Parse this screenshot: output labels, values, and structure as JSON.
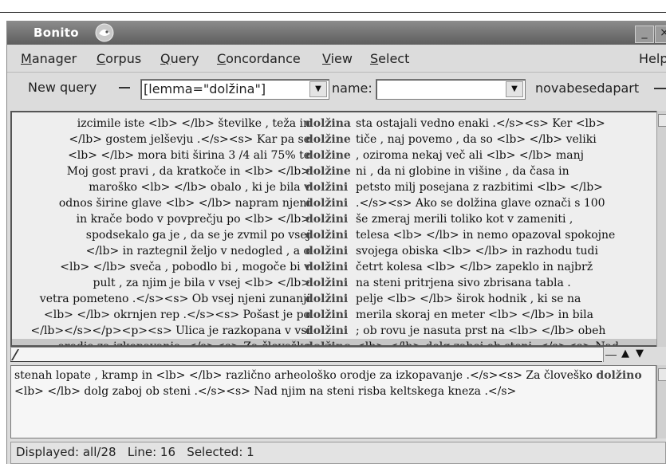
{
  "window": {
    "title": "Bonito"
  },
  "menu": [
    {
      "label": "Manager",
      "underline": "M",
      "rest": "anager"
    },
    {
      "label": "Corpus",
      "underline": "C",
      "rest": "orpus"
    },
    {
      "label": "Query",
      "underline": "Q",
      "rest": "uery"
    },
    {
      "label": "Concordance",
      "underline": "C",
      "rest": "oncordance"
    },
    {
      "label": "View",
      "underline": "V",
      "rest": "iew"
    },
    {
      "label": "Select",
      "underline": "S",
      "rest": "elect"
    },
    {
      "label": "Help",
      "underline": "",
      "rest": "Help"
    }
  ],
  "query_bar": {
    "new_query_label": "New query",
    "query_value": "[lemma=\"dolžina\"]",
    "name_label": "name:",
    "name_value": "",
    "corpus": "novabesedapart"
  },
  "concordance": {
    "rows": [
      {
        "left": "izcimile iste <lb> </lb> številke , teža in",
        "kw": "dolžina",
        "right": "sta ostajali vedno enaki .</s><s> Ker <lb>"
      },
      {
        "left": "</lb> gostem jelševju .</s><s> Kar pa se",
        "kw": "dolžine",
        "right": "tiče , naj povemo , da so <lb> </lb> veliki"
      },
      {
        "left": "<lb> </lb> mora biti širina 3 /4 ali 75% te",
        "kw": "dolžine",
        "right": ", oziroma nekaj več ali <lb> </lb> manj"
      },
      {
        "left": "Moj gost pravi , da kratkoče in <lb> </lb>",
        "kw": "dolžine",
        "right": "ni , da ni globine in višine , da časa in"
      },
      {
        "left": "maroško <lb> </lb> obalo , ki je bila v",
        "kw": "dolžini",
        "right": "petsto milj posejana z razbitimi <lb> </lb>"
      },
      {
        "left": "odnos širine glave <lb> </lb> napram njeni",
        "kw": "dolžini",
        "right": ".</s><s> Ako se dolžina glave označi s 100"
      },
      {
        "left": "in krače bodo v povprečju po <lb> </lb>",
        "kw": "dolžini",
        "right": "še zmeraj merili toliko kot v zameniti ,"
      },
      {
        "left": "spodsekalo ga je , da se je zvmil po vsej",
        "kw": "dolžini",
        "right": "telesa <lb> </lb> in nemo opazoval spokojne"
      },
      {
        "left": "</lb> in raztegnil željo v nedogled , a o",
        "kw": "dolžini",
        "right": "svojega obiska <lb> </lb> in razhodu tudi"
      },
      {
        "left": "<lb> </lb> sveča , pobodlo bi , mogoče bi v",
        "kw": "dolžini",
        "right": "četrt kolesa <lb> </lb> zapeklo in najbrž"
      },
      {
        "left": "pult , za njim je bila v vsej <lb> </lb>",
        "kw": "dolžini",
        "right": "na steni pritrjena sivo zbrisana tabla ."
      },
      {
        "left": "vetra pometeno .</s><s> Ob vsej njeni zunanji",
        "kw": "dolžini",
        "right": "pelje <lb> </lb> širok hodnik , ki se na"
      },
      {
        "left": "<lb> </lb> okrnjen rep .</s><s> Pošast je po",
        "kw": "dolžini",
        "right": "merila skoraj en meter <lb> </lb> in bila"
      },
      {
        "left": "</lb></s></p><p><s> Ulica je razkopana v vsi",
        "kw": "dolžini",
        "right": "; ob rovu je nasuta prst na <lb> </lb> obeh"
      },
      {
        "left": "orodje za izkopavanje .</s><s> Za človeško",
        "kw": "dolžino",
        "right": "<lb> </lb> dolg zaboj ob steni .</s><s> Nad"
      }
    ],
    "selected_index": 14
  },
  "context": {
    "line1_text": "stenah lopate , kramp in <lb> </lb> različno arheološko orodje za izkopavanje .</s><s> Za človeško",
    "line1_kw": "dolžino",
    "line2_text": "<lb> </lb> dolg zaboj ob steni .</s><s> Nad njim na steni risba keltskega kneza .</s>"
  },
  "status": {
    "text": "Displayed: all/28   Line: 16   Selected: 1"
  },
  "colors": {
    "titlebar": "#707070",
    "selected_row": "#c6c6c6",
    "keyword": "#444444"
  }
}
